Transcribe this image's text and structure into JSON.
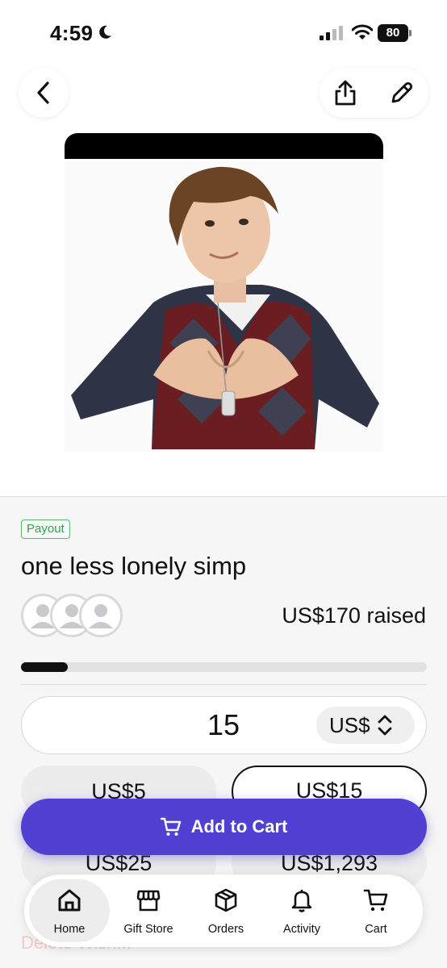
{
  "status_bar": {
    "time": "4:59",
    "battery": "80"
  },
  "wish": {
    "badge": "Payout",
    "title": "one less lonely simp",
    "raised": "US$170 raised",
    "progress": 0.115
  },
  "amount": {
    "value": "15",
    "currency": "US$"
  },
  "presets": [
    {
      "label": "US$5",
      "selected": false
    },
    {
      "label": "US$15",
      "selected": true
    },
    {
      "label": "US$25",
      "selected": false
    },
    {
      "label": "US$1,293",
      "selected": false
    }
  ],
  "add_to_cart": {
    "label": "Add to Cart"
  },
  "delete_wish": {
    "label": "Delete Wish..."
  },
  "tabs": [
    {
      "label": "Home",
      "icon": "home-icon",
      "active": true
    },
    {
      "label": "Gift Store",
      "icon": "store-icon",
      "active": false
    },
    {
      "label": "Orders",
      "icon": "box-icon",
      "active": false
    },
    {
      "label": "Activity",
      "icon": "bell-icon",
      "active": false
    },
    {
      "label": "Cart",
      "icon": "cart-icon",
      "active": false
    }
  ],
  "colors": {
    "accent": "#5140d1",
    "payout_green": "#3d9a52",
    "progress": "#111111"
  }
}
